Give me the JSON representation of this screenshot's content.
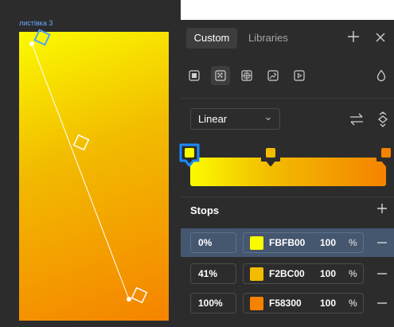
{
  "canvas": {
    "artboard_label": "листівка 3",
    "gradient_colors": [
      "#FBFB00",
      "#F2BC00",
      "#F58300"
    ]
  },
  "panel": {
    "tabs": [
      {
        "label": "Custom",
        "active": true
      },
      {
        "label": "Libraries",
        "active": false
      }
    ],
    "header_icons": [
      "plus-icon",
      "close-icon"
    ],
    "fill_types": [
      "solid-fill-icon",
      "gradient-fill-icon",
      "image-fill-icon",
      "pattern-fill-icon",
      "video-fill-icon"
    ],
    "active_fill_type": "gradient-fill-icon",
    "type_select": {
      "value": "Linear"
    },
    "type_icons": [
      "swap-icon",
      "rotate-icon"
    ],
    "stops_title": "Stops",
    "stops": [
      {
        "position": "0%",
        "hex": "FBFB00",
        "color": "#FBFB00",
        "opacity": "100",
        "unit": "%",
        "selected": true
      },
      {
        "position": "41%",
        "hex": "F2BC00",
        "color": "#F2BC00",
        "opacity": "100",
        "unit": "%",
        "selected": false
      },
      {
        "position": "100%",
        "hex": "F58300",
        "color": "#F58300",
        "opacity": "100",
        "unit": "%",
        "selected": false
      }
    ]
  },
  "colors": {
    "accent": "#1a8cff",
    "panel_bg": "#2c2c2c",
    "selected_row": "#45566f"
  }
}
